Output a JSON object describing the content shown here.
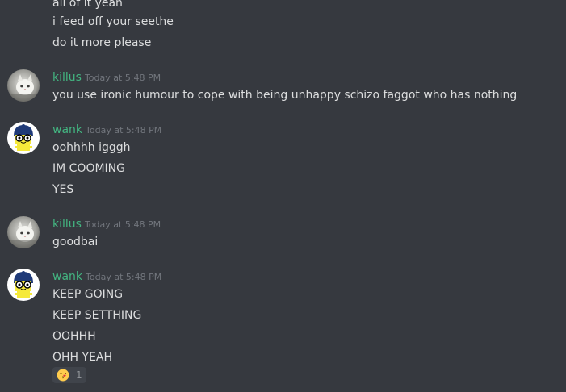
{
  "messages": {
    "partial_top": {
      "lines": [
        "all of it yeah",
        "i feed off your seethe",
        "do it more please"
      ]
    },
    "group1": {
      "username": "killus",
      "timestamp": "Today at 5:48 PM",
      "avatar_icon": "cat-avatar-icon",
      "lines": [
        "you use ironic humour to cope with being unhappy schizo faggot who has nothing"
      ]
    },
    "group2": {
      "username": "wank",
      "timestamp": "Today at 5:48 PM",
      "avatar_icon": "mametchi-avatar-icon",
      "lines": [
        "oohhhh igggh",
        "IM COOMING",
        "YES"
      ]
    },
    "group3": {
      "username": "killus",
      "timestamp": "Today at 5:48 PM",
      "avatar_icon": "cat-avatar-icon",
      "lines": [
        "goodbai"
      ]
    },
    "group4": {
      "username": "wank",
      "timestamp": "Today at 5:48 PM",
      "avatar_icon": "mametchi-avatar-icon",
      "lines": [
        "KEEP GOING",
        "KEEP SETTHING",
        "OOHHH",
        "OHH YEAH"
      ],
      "reaction": {
        "emoji_icon": "kissing-face-emoji-icon",
        "count": "1"
      }
    }
  },
  "colors": {
    "background": "#36393f",
    "username": "#43b581",
    "message_text": "#dcddde",
    "timestamp": "#72767d",
    "reaction_bg": "#40444b"
  }
}
